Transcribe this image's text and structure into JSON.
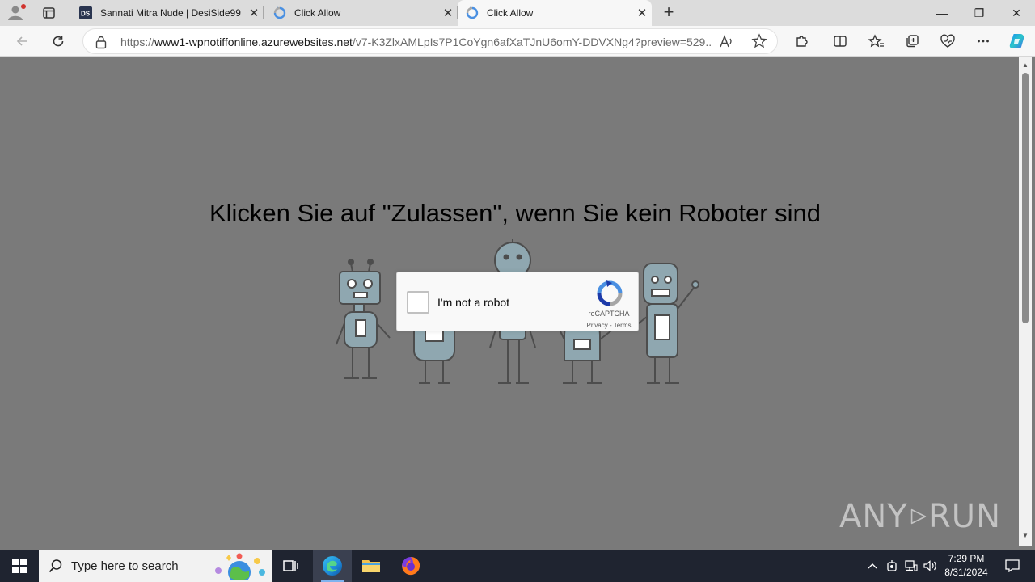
{
  "browser": {
    "tabs": [
      {
        "title": "Sannati Mitra Nude | DesiSide99",
        "favicon": "DS",
        "active": false
      },
      {
        "title": "Click Allow",
        "favicon": "recaptcha-icon",
        "active": false
      },
      {
        "title": "Click Allow",
        "favicon": "recaptcha-icon",
        "active": true
      }
    ],
    "new_tab_symbol": "+",
    "window_controls": {
      "minimize": "—",
      "restore": "❐",
      "close": "✕"
    },
    "url": {
      "prefix": "https://",
      "host": "www1-wpnotiffonline.azurewebsites.net",
      "path": "/v7-K3ZlxAMLpIs7P1CoYgn6afXaTJnU6omY-DDVXNg4?preview=529..."
    },
    "toolbar_icons": [
      "back-icon",
      "refresh-icon",
      "extensions-icon",
      "split-screen-icon",
      "favorites-icon",
      "collections-icon",
      "browser-essentials-icon",
      "more-icon",
      "copilot-icon"
    ]
  },
  "page": {
    "headline": "Klicken Sie auf \"Zulassen\", wenn Sie kein Roboter sind",
    "captcha": {
      "label": "I'm not a robot",
      "brand": "reCAPTCHA",
      "privacy": "Privacy",
      "separator": " - ",
      "terms": "Terms"
    },
    "watermark_left": "ANY",
    "watermark_right": "RUN"
  },
  "taskbar": {
    "search_placeholder": "Type here to search",
    "time": "7:29 PM",
    "date": "8/31/2024",
    "apps": [
      "task-view-icon",
      "edge-icon",
      "file-explorer-icon",
      "firefox-icon"
    ]
  },
  "colors": {
    "page_bg": "#7a7a7a",
    "taskbar_bg": "#1f2430",
    "edge_blue": "#0c59a4",
    "recaptcha_blue": "#4a90e2"
  }
}
